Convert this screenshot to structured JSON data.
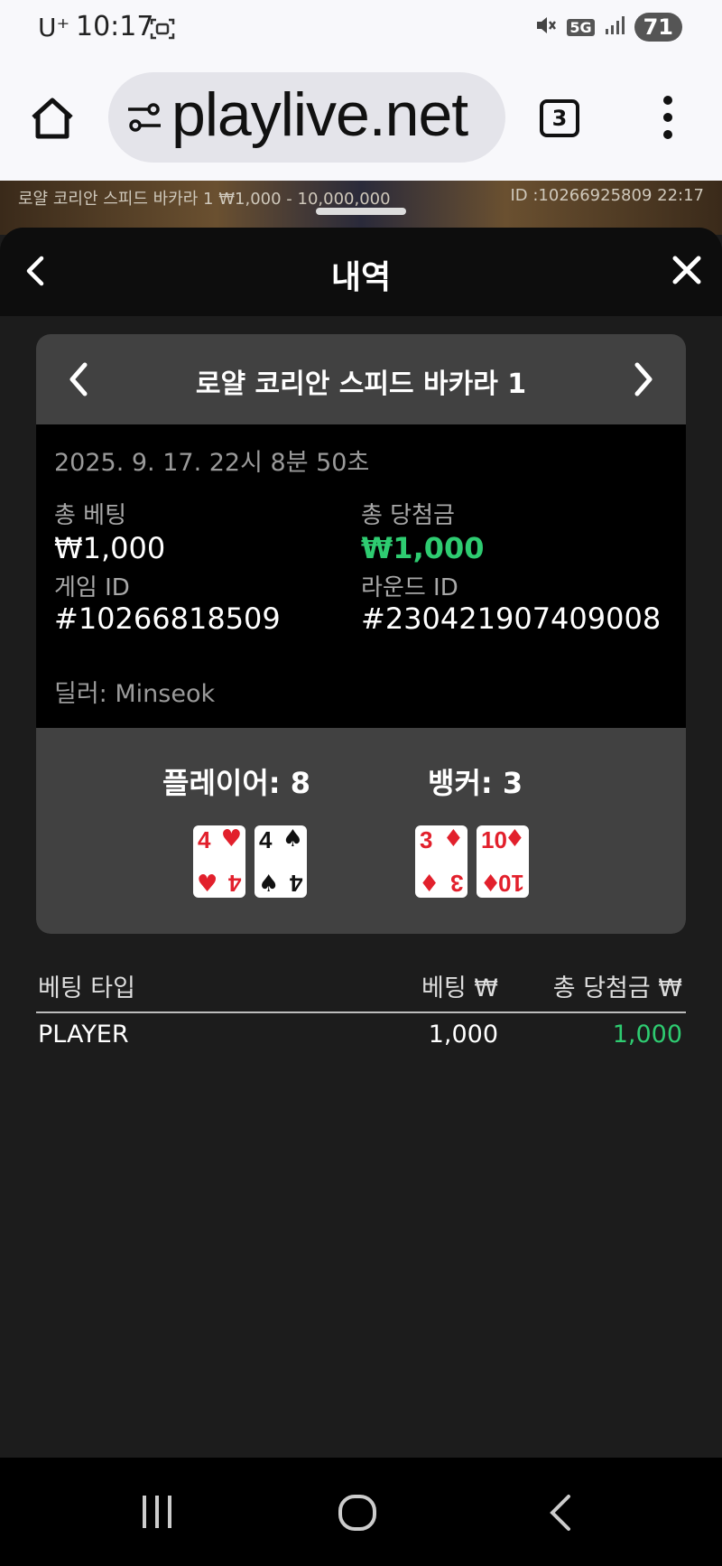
{
  "status_bar": {
    "carrier": "U⁺",
    "time": "10:17",
    "network": "5G",
    "battery": "71"
  },
  "browser": {
    "url": "playlive.net",
    "tab_count": "3"
  },
  "game_strip": {
    "left_text": "로얄 코리안 스피드 바카라 1 ₩1,000 - 10,000,000",
    "right_text": "ID :10266925809 22:17"
  },
  "sheet": {
    "title": "내역"
  },
  "card": {
    "game_name": "로얄 코리안 스피드 바카라 1",
    "date": "2025. 9. 17. 22시 8분 50초",
    "total_bet_label": "총 베팅",
    "total_bet_value": "₩1,000",
    "total_win_label": "총 당첨금",
    "total_win_value": "₩1,000",
    "game_id_label": "게임 ID",
    "game_id_value": "#10266818509",
    "round_id_label": "라운드 ID",
    "round_id_value": "#230421907409008",
    "dealer": "딜러: Minseok",
    "player_score": "플레이어: 8",
    "banker_score": "뱅커: 3",
    "player_cards": [
      {
        "rank": "4",
        "suit": "♥",
        "color": "#e2202c"
      },
      {
        "rank": "4",
        "suit": "♠",
        "color": "#111111"
      }
    ],
    "banker_cards": [
      {
        "rank": "3",
        "suit": "♦",
        "color": "#e2202c"
      },
      {
        "rank": "10",
        "suit": "♦",
        "color": "#e2202c"
      }
    ]
  },
  "bets_table": {
    "headers": [
      "베팅 타입",
      "베팅 ₩",
      "총 당첨금 ₩"
    ],
    "rows": [
      {
        "type": "PLAYER",
        "bet": "1,000",
        "win": "1,000"
      }
    ]
  },
  "colors": {
    "accent_green": "#2ecc71",
    "card_red": "#e2202c"
  }
}
